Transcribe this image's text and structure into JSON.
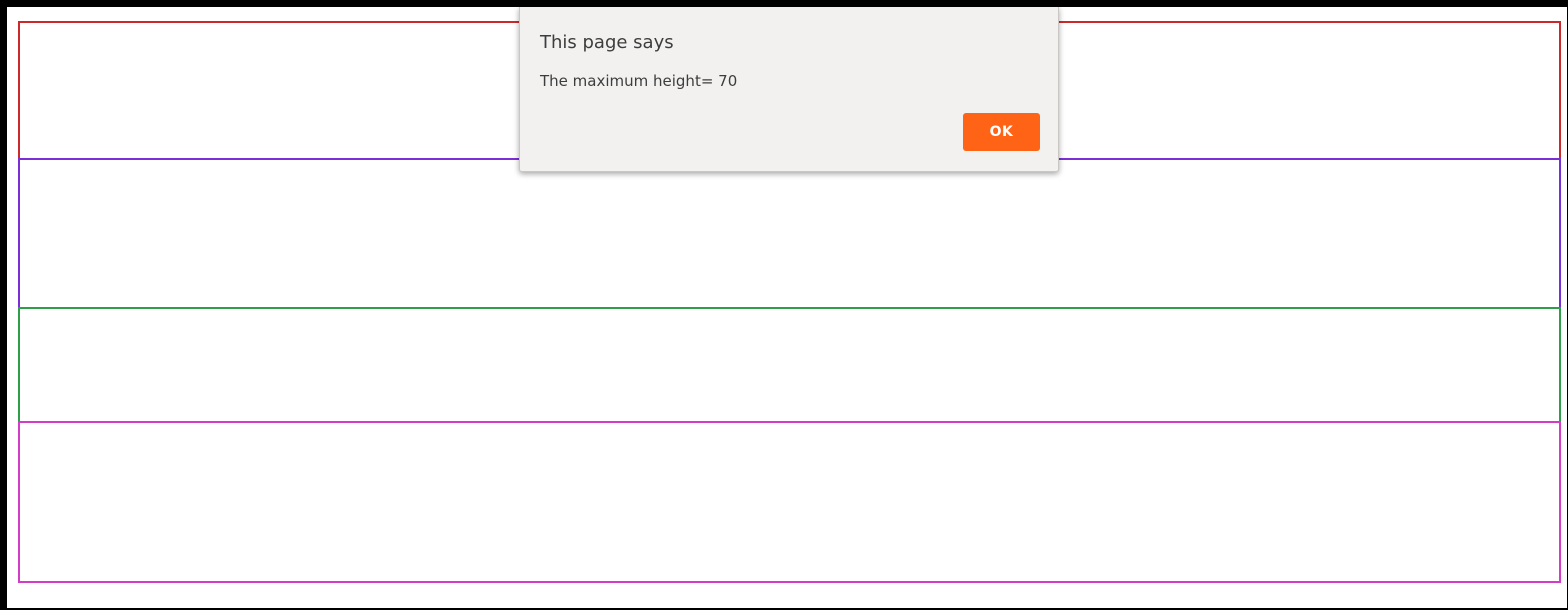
{
  "page": {
    "background": "#ffffff",
    "frame_color": "#000000",
    "boxes": [
      {
        "name": "red-box",
        "border_color": "#cc2a2a"
      },
      {
        "name": "purple-box",
        "border_color": "#7a2fd6"
      },
      {
        "name": "green-box",
        "border_color": "#2f9e4a"
      },
      {
        "name": "magenta-box",
        "border_color": "#d43cc8"
      }
    ]
  },
  "alert": {
    "title": "This page says",
    "message": "The maximum height= 70",
    "ok_label": "OK",
    "background": "#f2f1f0",
    "button_color": "#ff6316"
  }
}
